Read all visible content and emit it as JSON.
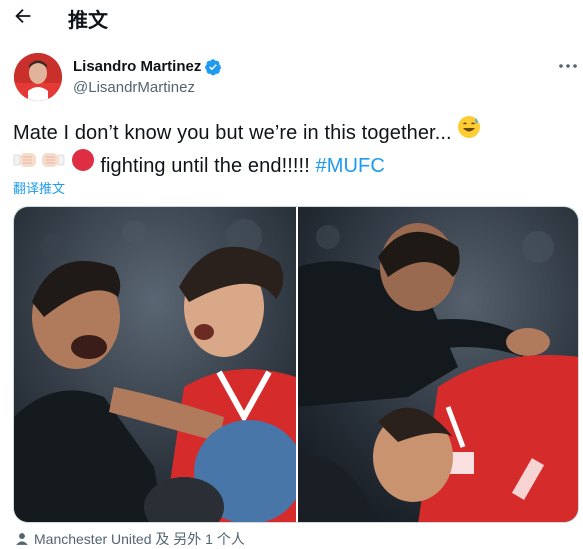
{
  "header": {
    "title": "推文"
  },
  "author": {
    "name": "Lisandro Martinez",
    "handle": "@LisandrMartinez",
    "verified": true
  },
  "tweet": {
    "line1": "Mate I don’t know you but we’re in this together...",
    "line2_text": "fighting until the end!!!!!",
    "hashtag": "#MUFC",
    "emojis": [
      "sweat-smile-emoji",
      "fist-bump-left-emoji",
      "fist-bump-right-emoji",
      "red-circle-emoji"
    ]
  },
  "translate_label": "翻译推文",
  "tagged": {
    "text": "Manchester United 及 另外 1 个人"
  },
  "colors": {
    "link": "#1d9bf0",
    "secondary": "#536471",
    "verified": "#1d9bf0",
    "kit_red": "#d62b2b"
  }
}
